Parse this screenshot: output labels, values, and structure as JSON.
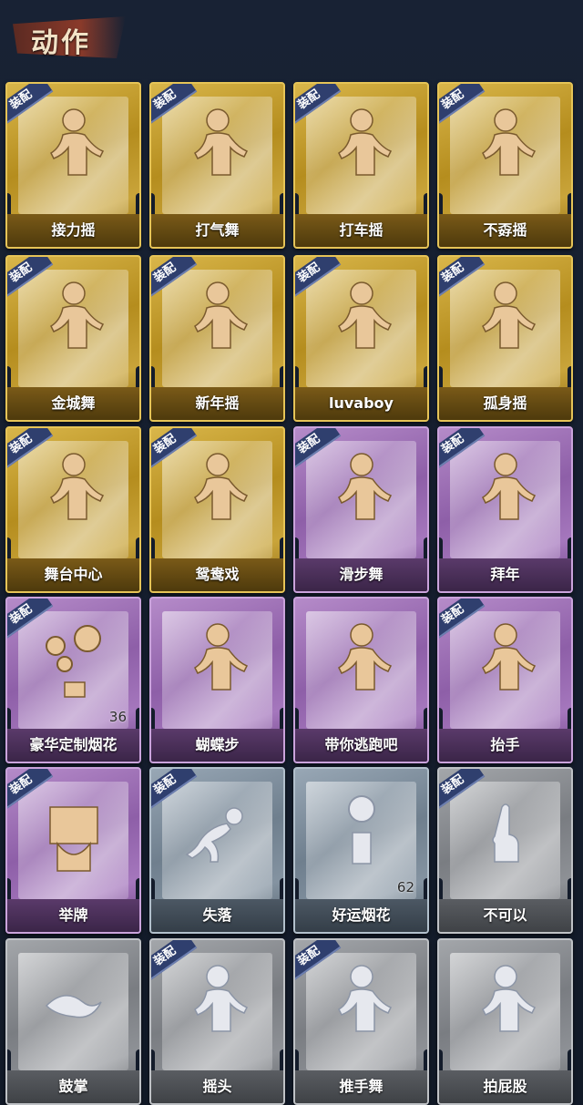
{
  "header": {
    "title": "动作"
  },
  "badge_text": "装配",
  "colors": {
    "gold": "#c9a43a",
    "purple": "#8e5fa8",
    "blue": "#6f7f8e",
    "gray": "#7a7d82",
    "background": "#141c2b"
  },
  "cards": [
    {
      "label": "接力摇",
      "tier": "gold",
      "badge": true,
      "icon": "dance-figure-icon"
    },
    {
      "label": "打气舞",
      "tier": "gold",
      "badge": true,
      "icon": "dance-figure-icon"
    },
    {
      "label": "打车摇",
      "tier": "gold",
      "badge": true,
      "icon": "dance-figure-icon"
    },
    {
      "label": "不孬摇",
      "tier": "gold",
      "badge": true,
      "icon": "dance-figure-icon"
    },
    {
      "label": "金城舞",
      "tier": "gold",
      "badge": true,
      "icon": "dance-figure-icon"
    },
    {
      "label": "新年摇",
      "tier": "gold",
      "badge": true,
      "icon": "dance-figure-icon"
    },
    {
      "label": "luvaboy",
      "tier": "gold",
      "badge": true,
      "icon": "dance-figure-icon"
    },
    {
      "label": "孤身摇",
      "tier": "gold",
      "badge": true,
      "icon": "dance-figure-icon"
    },
    {
      "label": "舞台中心",
      "tier": "gold",
      "badge": true,
      "icon": "dance-figure-icon"
    },
    {
      "label": "鸳鸯戏",
      "tier": "gold",
      "badge": true,
      "icon": "dance-figure-icon"
    },
    {
      "label": "滑步舞",
      "tier": "purple",
      "badge": true,
      "icon": "dance-figure-icon"
    },
    {
      "label": "拜年",
      "tier": "purple",
      "badge": true,
      "icon": "bow-figure-icon"
    },
    {
      "label": "豪华定制烟花",
      "tier": "purple",
      "badge": true,
      "icon": "fireworks-icon",
      "count": "36"
    },
    {
      "label": "蝴蝶步",
      "tier": "purple",
      "badge": false,
      "icon": "dance-figure-icon"
    },
    {
      "label": "带你逃跑吧",
      "tier": "purple",
      "badge": false,
      "icon": "dance-figure-icon"
    },
    {
      "label": "抬手",
      "tier": "purple",
      "badge": true,
      "icon": "raise-hand-figure-icon"
    },
    {
      "label": "举牌",
      "tier": "purple",
      "badge": true,
      "icon": "hold-sign-icon"
    },
    {
      "label": "失落",
      "tier": "blue",
      "badge": true,
      "icon": "kneeling-figure-icon"
    },
    {
      "label": "好运烟花",
      "tier": "blue",
      "badge": false,
      "icon": "firework-can-icon",
      "count": "62"
    },
    {
      "label": "不可以",
      "tier": "gray",
      "badge": true,
      "icon": "finger-wag-icon"
    },
    {
      "label": "鼓掌",
      "tier": "gray",
      "badge": false,
      "icon": "clapping-hands-icon"
    },
    {
      "label": "摇头",
      "tier": "gray",
      "badge": true,
      "icon": "head-shake-figure-icon"
    },
    {
      "label": "推手舞",
      "tier": "gray",
      "badge": true,
      "icon": "push-dance-figure-icon"
    },
    {
      "label": "拍屁股",
      "tier": "gray",
      "badge": false,
      "icon": "butt-slap-figure-icon"
    }
  ]
}
